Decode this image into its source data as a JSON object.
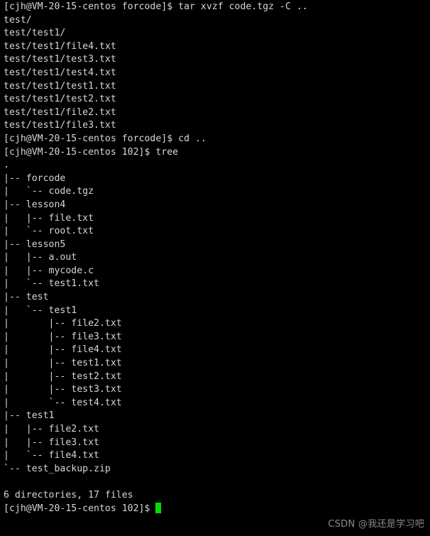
{
  "terminal": {
    "background_color": "#000000",
    "foreground_color": "#d6d6d6",
    "cursor_color": "#00e000",
    "watermark_color": "#8a8a8a",
    "prompt_user_host_1": "[cjh@VM-20-15-centos forcode]$",
    "prompt_user_host_2": "[cjh@VM-20-15-centos 102]$",
    "lines": [
      "[cjh@VM-20-15-centos forcode]$ tar xvzf code.tgz -C ..",
      "test/",
      "test/test1/",
      "test/test1/file4.txt",
      "test/test1/test3.txt",
      "test/test1/test4.txt",
      "test/test1/test1.txt",
      "test/test1/test2.txt",
      "test/test1/file2.txt",
      "test/test1/file3.txt",
      "[cjh@VM-20-15-centos forcode]$ cd ..",
      "[cjh@VM-20-15-centos 102]$ tree",
      ".",
      "|-- forcode",
      "|   `-- code.tgz",
      "|-- lesson4",
      "|   |-- file.txt",
      "|   `-- root.txt",
      "|-- lesson5",
      "|   |-- a.out",
      "|   |-- mycode.c",
      "|   `-- test1.txt",
      "|-- test",
      "|   `-- test1",
      "|       |-- file2.txt",
      "|       |-- file3.txt",
      "|       |-- file4.txt",
      "|       |-- test1.txt",
      "|       |-- test2.txt",
      "|       |-- test3.txt",
      "|       `-- test4.txt",
      "|-- test1",
      "|   |-- file2.txt",
      "|   |-- file3.txt",
      "|   `-- file4.txt",
      "`-- test_backup.zip",
      "",
      "6 directories, 17 files"
    ],
    "final_prompt": "[cjh@VM-20-15-centos 102]$ ",
    "watermark": "CSDN @我还是学习吧"
  }
}
